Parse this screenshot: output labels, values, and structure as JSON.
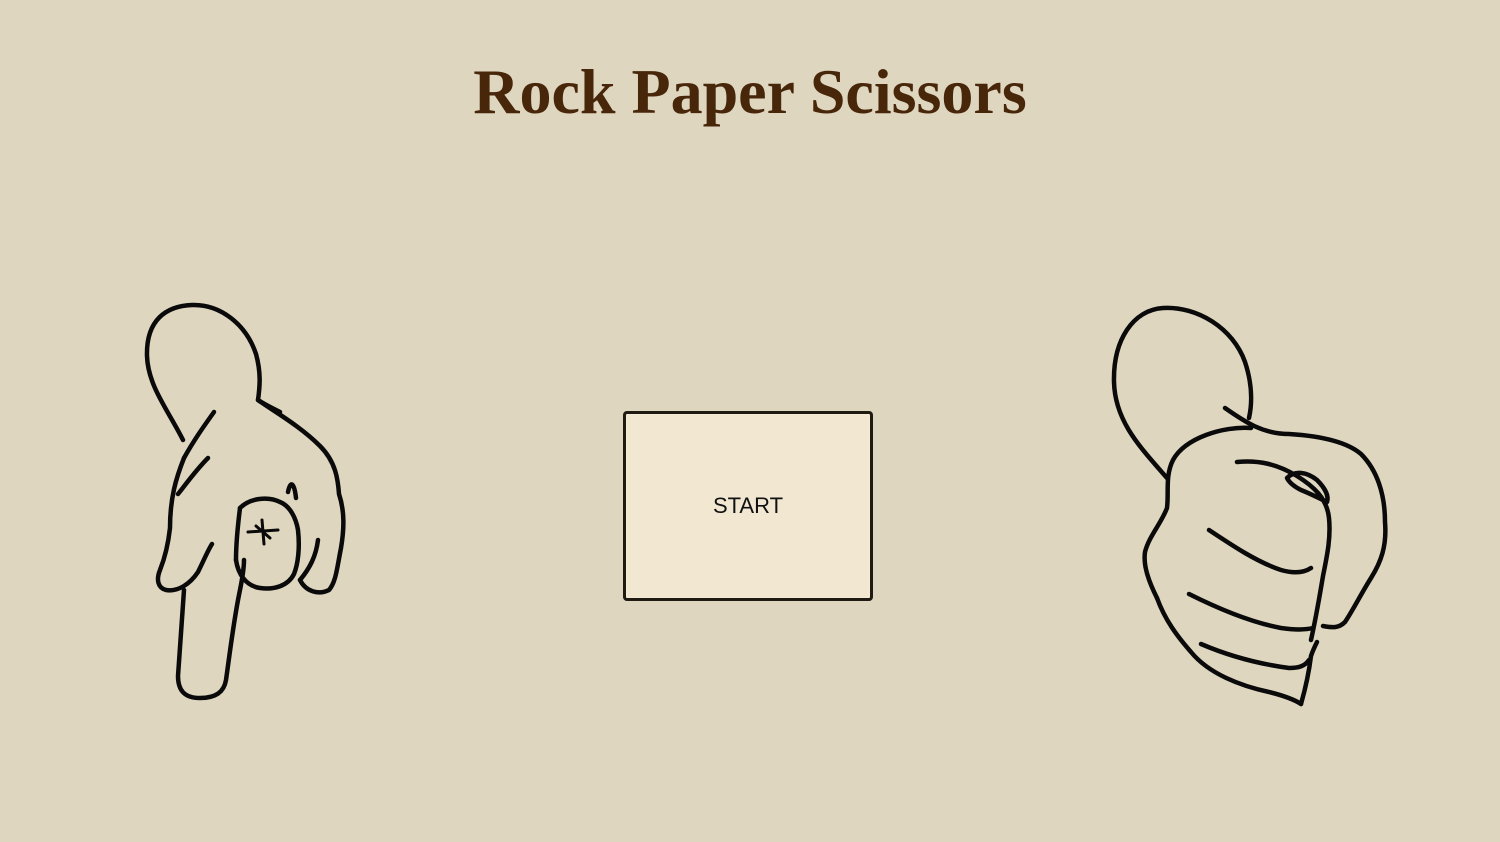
{
  "game": {
    "title": "Rock Paper Scissors",
    "start_label": "START"
  },
  "hands": {
    "player": {
      "icon": "pointing-down-hand-icon"
    },
    "opponent": {
      "icon": "fist-hand-icon"
    }
  },
  "colors": {
    "background": "#dfd6c0",
    "title": "#48260a",
    "button_fill": "#f2e8d2",
    "button_border": "#1f1a12",
    "outline": "#0a0a0a"
  }
}
